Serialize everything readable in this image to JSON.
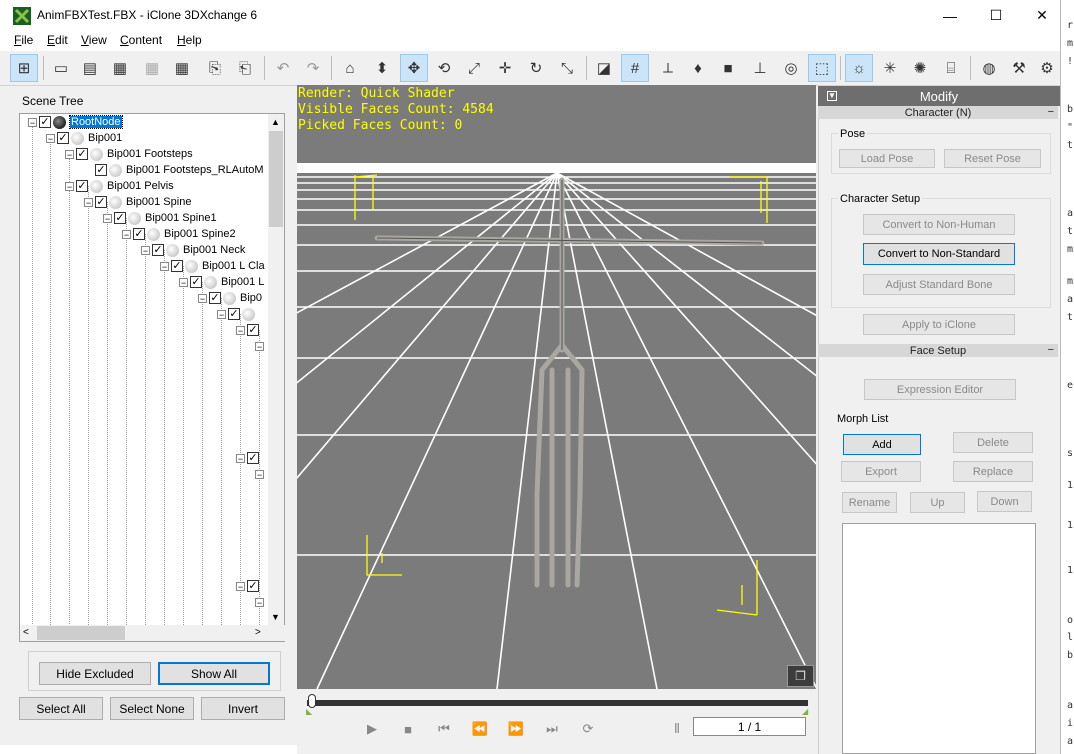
{
  "window": {
    "title": "AnimFBXTest.FBX - iClone 3DXchange 6",
    "minimize": "—",
    "maximize": "☐",
    "close": "✕"
  },
  "menu": [
    {
      "key": "F",
      "rest": "ile"
    },
    {
      "key": "E",
      "rest": "dit"
    },
    {
      "key": "V",
      "rest": "iew"
    },
    {
      "key": "C",
      "rest": "ontent"
    },
    {
      "key": "H",
      "rest": "elp"
    }
  ],
  "toolbar_icons": [
    "scene-tree-icon",
    "open-icon",
    "import-icon",
    "fbx-icon",
    "bvh-icon",
    "obj-icon",
    "export-icon",
    "export-alt-icon",
    "undo-icon",
    "redo-icon",
    "home-icon",
    "move-down-icon",
    "move-icon",
    "rotate-icon",
    "pick-icon",
    "pan-icon",
    "orbit-icon",
    "scale-icon",
    "shading-icon",
    "grid-icon",
    "axis-icon",
    "light-bulb-icon",
    "box-icon",
    "stage-icon",
    "globe-icon",
    "frame-icon",
    "light-icon",
    "spotlight-icon",
    "sun-icon",
    "library-icon",
    "sphere-icon",
    "wrench-icon",
    "settings-icon"
  ],
  "scene_tree": {
    "label": "Scene Tree",
    "nodes": [
      {
        "label": "RootNode",
        "selected": true
      },
      {
        "label": "Bip001"
      },
      {
        "label": "Bip001 Footsteps"
      },
      {
        "label": "Bip001 Footsteps_RLAutoM"
      },
      {
        "label": "Bip001 Pelvis"
      },
      {
        "label": "Bip001 Spine"
      },
      {
        "label": "Bip001 Spine1"
      },
      {
        "label": "Bip001 Spine2"
      },
      {
        "label": "Bip001 Neck"
      },
      {
        "label": "Bip001 L Cla"
      },
      {
        "label": "Bip001 L"
      },
      {
        "label": "Bip0"
      }
    ],
    "hide_excluded": "Hide Excluded",
    "show_all": "Show All",
    "select_all": "Select All",
    "select_none": "Select None",
    "invert": "Invert"
  },
  "viewport": {
    "render": "Render: Quick Shader",
    "visible_faces": "Visible Faces Count: 4584",
    "picked_faces": "Picked Faces Count: 0",
    "grid_color": "#ffffff",
    "background": "#7b7b7b",
    "marker_color": "#ffff00"
  },
  "timeline": {
    "frame": "1 / 1"
  },
  "modify": {
    "title": "Modify",
    "character_header": "Character (N)",
    "pose_label": "Pose",
    "load_pose": "Load Pose",
    "reset_pose": "Reset Pose",
    "char_setup_label": "Character Setup",
    "convert_non_human": "Convert to Non-Human",
    "convert_non_standard": "Convert to Non-Standard",
    "adjust_bone": "Adjust Standard Bone",
    "apply_iclone": "Apply to iClone",
    "face_header": "Face Setup",
    "expression_editor": "Expression Editor",
    "morph_list_label": "Morph List",
    "add": "Add",
    "delete": "Delete",
    "export": "Export",
    "replace": "Replace",
    "rename": "Rename",
    "up": "Up",
    "down": "Down"
  }
}
